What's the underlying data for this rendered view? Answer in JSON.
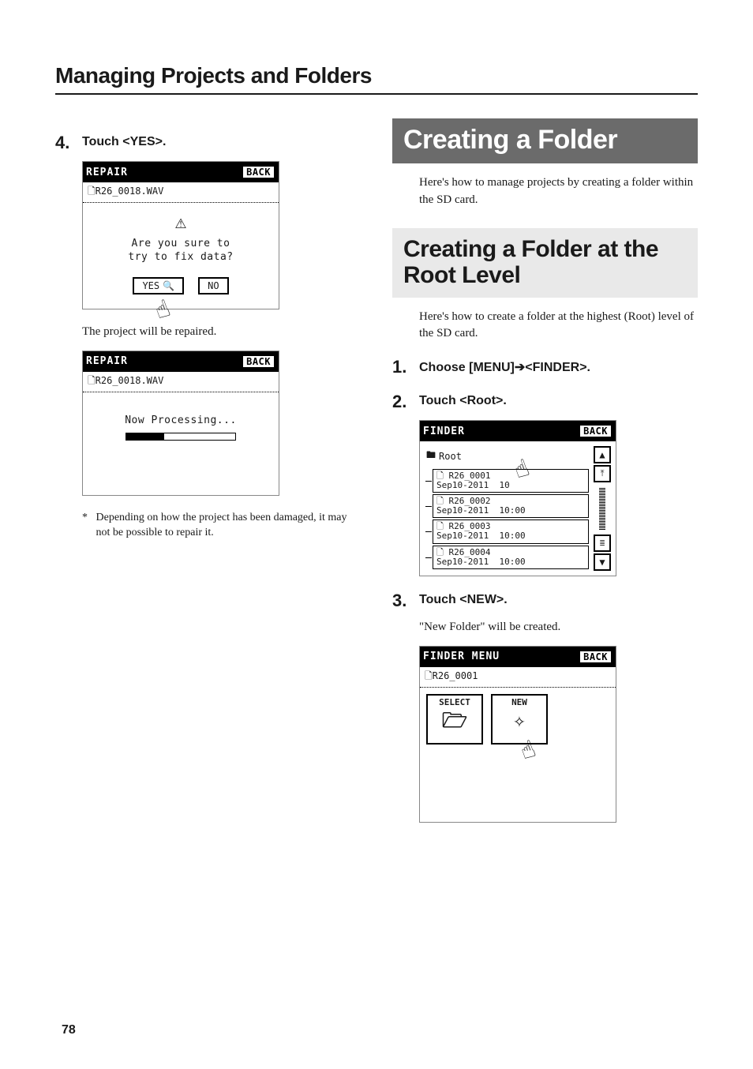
{
  "page_number": "78",
  "section_title": "Managing Projects and Folders",
  "left": {
    "step4_num": "4.",
    "step4_text": "Touch <YES>.",
    "repair_screen1": {
      "title": "REPAIR",
      "back": "BACK",
      "crumb": "R26_0018.WAV",
      "line1": "Are you sure to",
      "line2": "try to fix data?",
      "yes": "YES",
      "no": "NO"
    },
    "after_repair": "The project will be repaired.",
    "repair_screen2": {
      "title": "REPAIR",
      "back": "BACK",
      "crumb": "R26_0018.WAV",
      "processing": "Now Processing..."
    },
    "note": "Depending on how the project has been damaged, it may not be possible to repair it."
  },
  "right": {
    "h1": "Creating a Folder",
    "intro1": "Here's how to manage projects by creating a folder within the SD card.",
    "h2": "Creating a Folder at the Root Level",
    "intro2": "Here's how to create a folder at the highest (Root) level of the SD card.",
    "step1_num": "1.",
    "step1_text": "Choose [MENU]→<FINDER>.",
    "step2_num": "2.",
    "step2_text": "Touch <Root>.",
    "finder_screen": {
      "title": "FINDER",
      "back": "BACK",
      "root": "Root",
      "items": [
        {
          "name": "R26_0001",
          "date": "Sep10-2011",
          "time": "10"
        },
        {
          "name": "R26_0002",
          "date": "Sep10-2011",
          "time": "10:00"
        },
        {
          "name": "R26_0003",
          "date": "Sep10-2011",
          "time": "10:00"
        },
        {
          "name": "R26_0004",
          "date": "Sep10-2011",
          "time": "10:00"
        }
      ]
    },
    "step3_num": "3.",
    "step3_text": "Touch <NEW>.",
    "step3_body": "\"New Folder\" will be created.",
    "menu_screen": {
      "title": "FINDER MENU",
      "back": "BACK",
      "crumb": "R26_0001",
      "select": "SELECT",
      "new": "NEW"
    }
  }
}
